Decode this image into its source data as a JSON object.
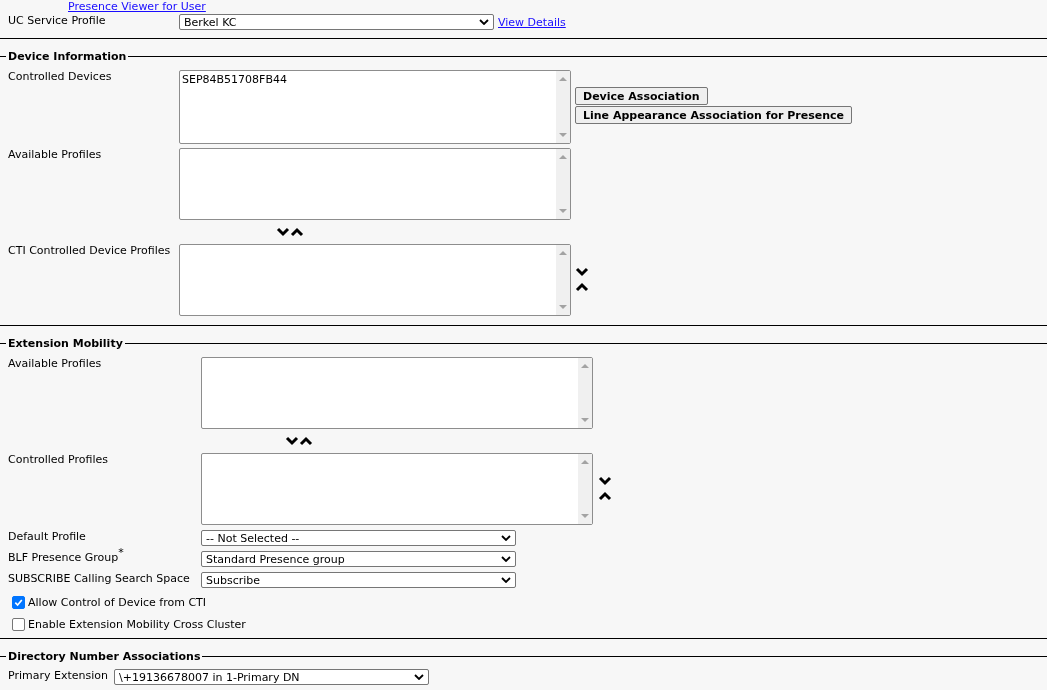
{
  "top": {
    "presence_link": "Presence Viewer for User",
    "uc_service_profile": {
      "label": "UC Service Profile",
      "value": "Berkel KC",
      "link": "View Details"
    }
  },
  "device_information": {
    "title": "Device Information",
    "controlled_devices": {
      "label": "Controlled Devices",
      "items": [
        "SEP84B51708FB44"
      ]
    },
    "buttons": [
      "Device Association",
      "Line Appearance Association for Presence"
    ],
    "available_profiles": {
      "label": "Available Profiles"
    },
    "cti_controlled_device_profiles": {
      "label": "CTI Controlled Device Profiles"
    }
  },
  "extension_mobility": {
    "title": "Extension Mobility",
    "available_profiles": {
      "label": "Available Profiles"
    },
    "controlled_profiles": {
      "label": "Controlled Profiles"
    },
    "selects": [
      {
        "label": "Default Profile",
        "value": "-- Not Selected --"
      },
      {
        "label": "BLF Presence Group$^{*}$",
        "value": "Standard Presence group"
      },
      {
        "label": "SUBSCRIBE Calling Search Space",
        "value": "Subscribe"
      }
    ],
    "checkboxes": [
      {
        "label": "Allow Control of Device from CTI",
        "checked": true
      },
      {
        "label": "Enable Extension Mobility Cross Cluster",
        "checked": false
      }
    ]
  },
  "directory_number_associations": {
    "title": "Directory Number Associations",
    "primary_extension": {
      "label": "Primary Extension",
      "value": "\\+19136678007 in 1-Primary DN"
    }
  }
}
